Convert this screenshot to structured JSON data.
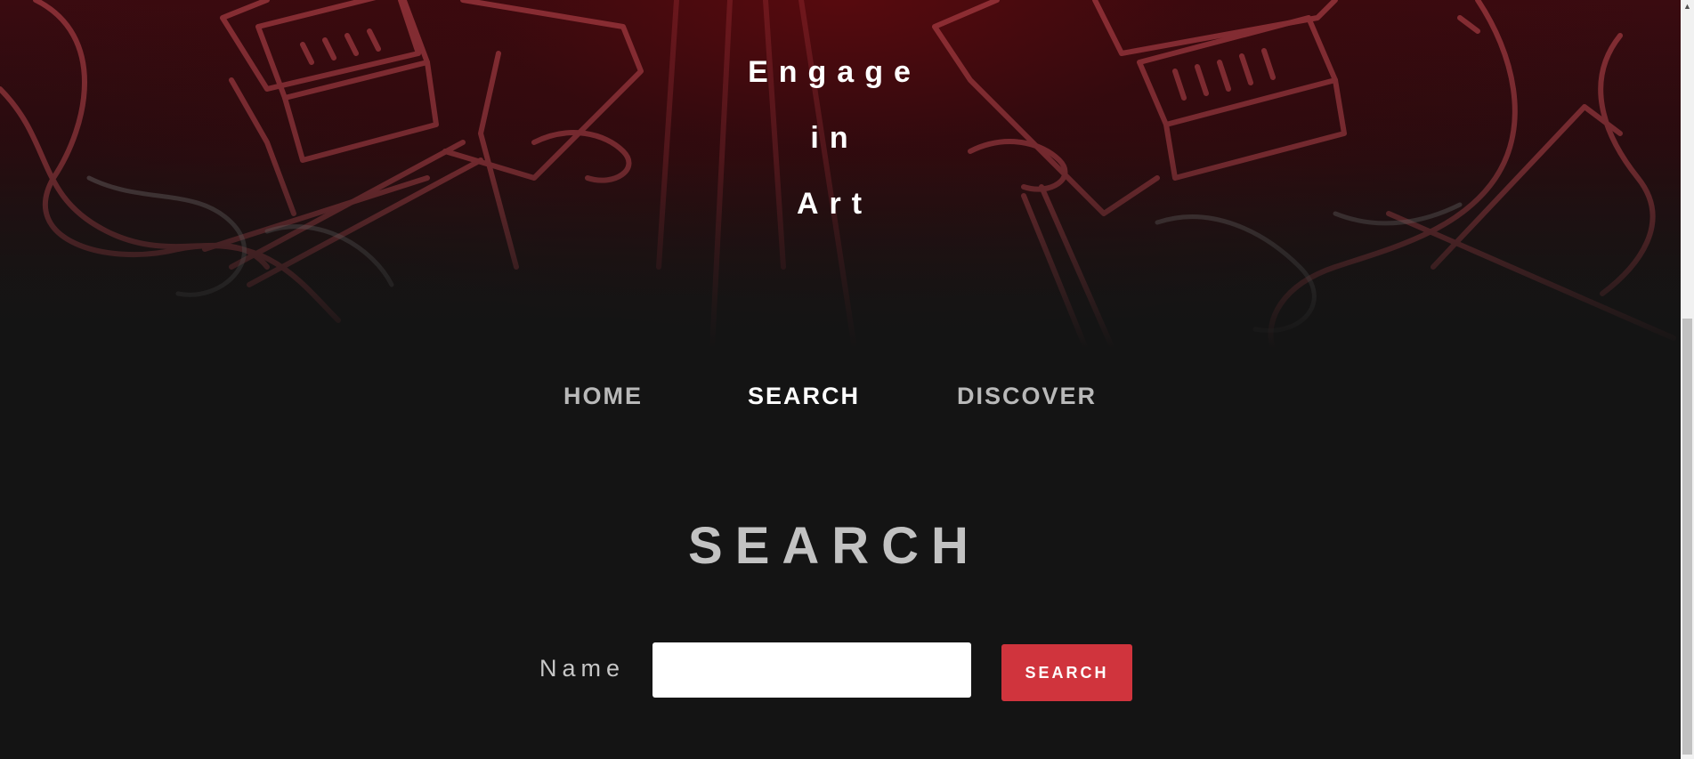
{
  "hero": {
    "title_lines": [
      "Engage",
      "in",
      "Art"
    ]
  },
  "nav": {
    "items": [
      {
        "label": "HOME"
      },
      {
        "label": "SEARCH",
        "active": true
      },
      {
        "label": "DISCOVER"
      }
    ]
  },
  "search": {
    "heading": "SEARCH",
    "name_label": "Name",
    "name_value": "",
    "button_label": "SEARCH"
  },
  "colors": {
    "background": "#141414",
    "accent": "#d0343d",
    "nav_inactive": "#b9b9b9",
    "nav_active": "#ffffff",
    "hero_red": "#8a1a22"
  },
  "icons": {
    "scroll_up": "scroll-up-arrow-icon"
  }
}
